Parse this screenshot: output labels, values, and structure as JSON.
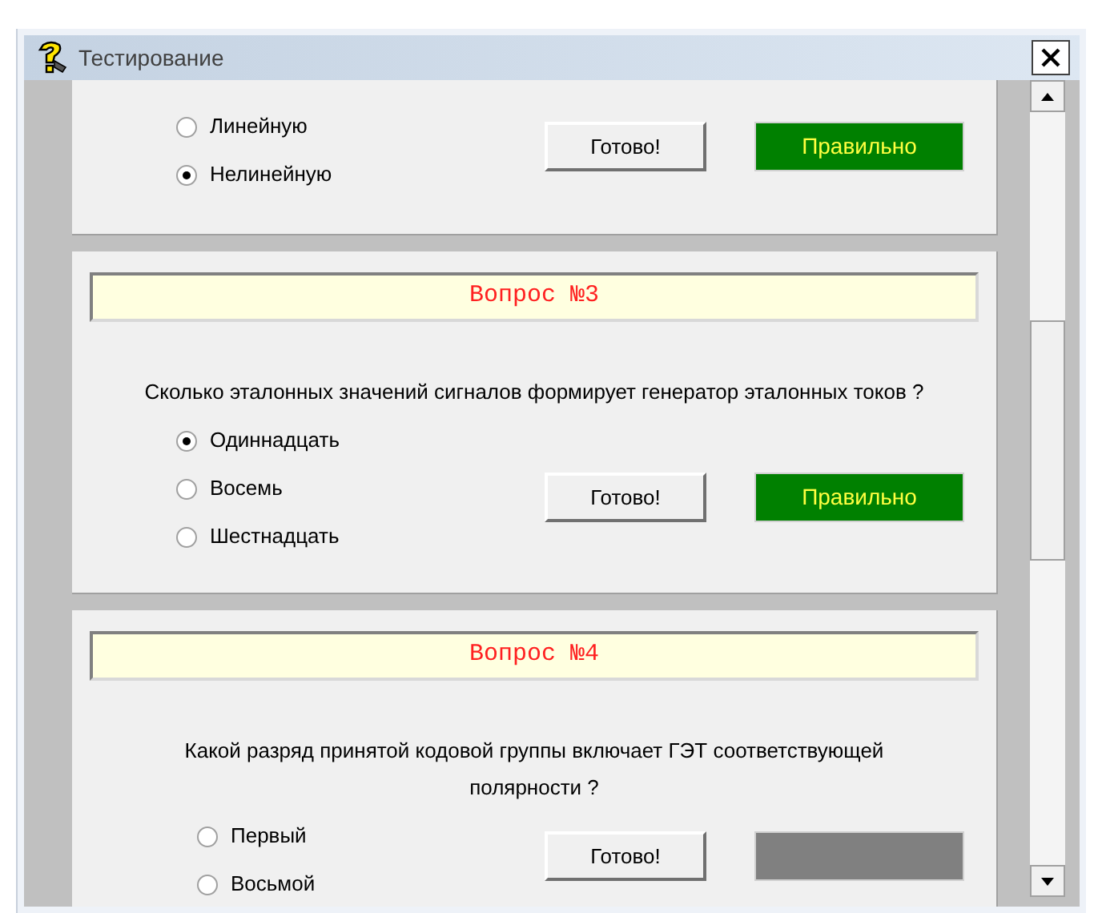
{
  "window": {
    "title": "Тестирование"
  },
  "questions": [
    {
      "options": [
        {
          "label": "Линейную",
          "selected": false
        },
        {
          "label": "Нелинейную",
          "selected": true
        }
      ],
      "submit": "Готово!",
      "result": {
        "kind": "verdict",
        "label": "Правильно"
      }
    },
    {
      "header": "Вопрос №3",
      "text": "Сколько эталонных значений сигналов формирует генератор эталонных токов ?",
      "options": [
        {
          "label": "Одиннадцать",
          "selected": true
        },
        {
          "label": "Восемь",
          "selected": false
        },
        {
          "label": "Шестнадцать",
          "selected": false
        }
      ],
      "submit": "Готово!",
      "result": {
        "kind": "verdict",
        "label": "Правильно"
      }
    },
    {
      "header": "Вопрос №4",
      "text": "Какой разряд принятой кодовой группы включает ГЭТ соответствующей полярности ?",
      "options": [
        {
          "label": "Первый",
          "selected": false
        },
        {
          "label": "Восьмой",
          "selected": false
        }
      ],
      "submit": "Готово!",
      "result": {
        "kind": "empty"
      }
    }
  ]
}
